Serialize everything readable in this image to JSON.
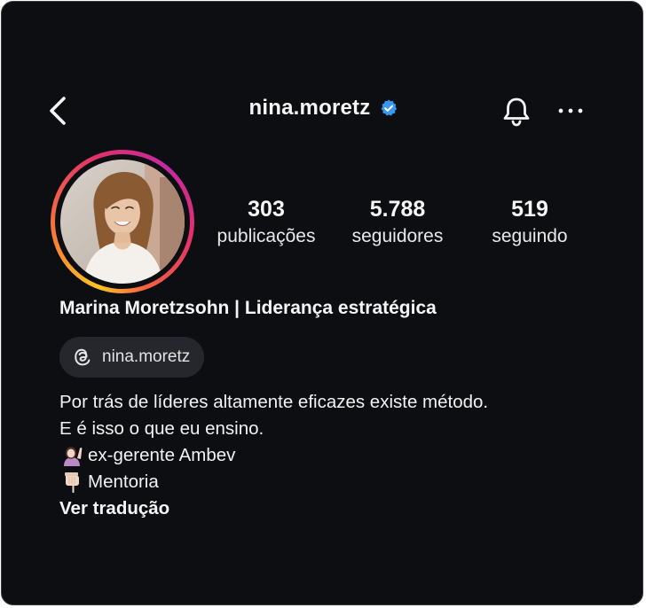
{
  "header": {
    "username": "nina.moretz",
    "back_icon": "chevron-left-icon",
    "verified_icon": "verified-badge-icon",
    "verified_color": "#3897f0",
    "bell_icon": "bell-icon",
    "more_icon": "more-horizontal-icon"
  },
  "profile": {
    "avatar": "profile-photo",
    "stats": {
      "posts": {
        "value": "303",
        "label": "publicações"
      },
      "followers": {
        "value": "5.788",
        "label": "seguidores"
      },
      "following": {
        "value": "519",
        "label": "seguindo"
      }
    },
    "full_name": "Marina Moretzsohn | Liderança estratégica",
    "threads": {
      "icon": "threads-icon",
      "handle": "nina.moretz"
    },
    "bio": {
      "line1": "Por trás de líderes altamente eficazes existe método.",
      "line2": "E é isso o que eu ensino.",
      "line3": "ex-gerente Ambev",
      "line3_icon": "woman-raising-hand-icon",
      "line4": "Mentoria",
      "line4_icon": "pointing-down-hand-icon",
      "translate": "Ver tradução"
    }
  },
  "colors": {
    "background": "#0c0e12",
    "text": "#f5f5f5",
    "chip_bg": "#25272c"
  }
}
